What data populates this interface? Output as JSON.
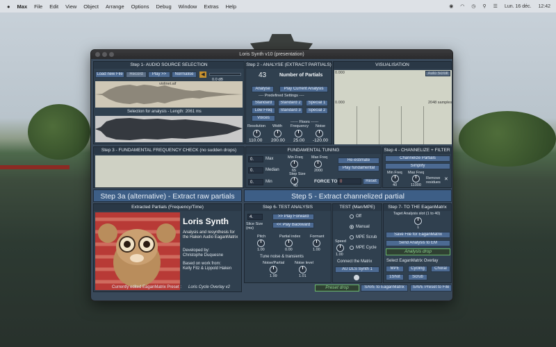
{
  "menubar": {
    "apple": "",
    "items": [
      "Max",
      "File",
      "Edit",
      "View",
      "Object",
      "Arrange",
      "Options",
      "Debug",
      "Window",
      "Extras",
      "Help"
    ],
    "date": "Lun. 16 déc.",
    "time": "12:42"
  },
  "window": {
    "title": "Loris Synth v10 (presentation)"
  },
  "step1": {
    "title": "Step 1- AUDIO SOURCE SELECTION",
    "load": "Load new File",
    "record": "Record",
    "play": "Play >>",
    "normalise": "Normalise",
    "db": "0.0 dB",
    "filename": "violinet.aif",
    "selection_label": "Selection for analysis - Length:",
    "selection_length": "2061",
    "selection_unit": "ms"
  },
  "step2": {
    "title": "Step 2 - ANALYSE (EXTRACT PARTIALS)",
    "partials_num": "43",
    "partials_label": "Number of  Partials",
    "analyse": "Analyse",
    "play_current": "Play Current Analysis",
    "predef_label": "---- Predefined Settings ----",
    "presets": [
      "Standard",
      "Standard 2",
      "Special 1",
      "Low Freq",
      "Standard 3",
      "Special 2",
      "Voices"
    ],
    "floors_label": "------ Floors ------",
    "params": [
      {
        "label": "Resolution",
        "value": "110.00"
      },
      {
        "label": "Width",
        "value": "200.00"
      },
      {
        "label": "Frequency",
        "value": "25.00"
      },
      {
        "label": "Noise",
        "value": "-120.00"
      }
    ]
  },
  "visual": {
    "title": "VISUALISATION",
    "auto_scroll": "Auto Scroll",
    "top_val": "0.000",
    "mid_val": "0.000",
    "samples": "2048 samples"
  },
  "step3": {
    "title": "Step 3 - FUNDAMENTAL FREQUENCY CHECK (no sudden drops)"
  },
  "tuning": {
    "title": "FUNDAMENTAL TUNING",
    "max_label": "Max",
    "median_label": "Median",
    "min_label": "Min",
    "max_val": "0.",
    "median_val": "0.",
    "min_val": "0.",
    "min_freq": "Min Freq",
    "min_freq_val": "65",
    "max_freq": "Max Freq",
    "max_freq_val": "2000",
    "step_size": "Step Size",
    "step_val": "40",
    "reestimate": "Re-estimate",
    "play_fund": "Play fundamental",
    "force_to": "FORCE TO",
    "force_val": "0",
    "reset": "Reset"
  },
  "step4": {
    "title": "Step 4 - CHANNELIZE + FILTER",
    "channelize": "Channelize Partials",
    "simplify": "Simplify",
    "min_freq": "Min Freq",
    "min_val": "40",
    "max_freq": "Max Freq",
    "max_val": "11000",
    "remove": "Remove residues",
    "close": "✕"
  },
  "step3a": {
    "title": "Step 3a (alternative) - Extract raw partials"
  },
  "step5": {
    "title": "Step 5 - Extract channelized partial"
  },
  "extracted": {
    "title": "Extracted Partials (Frequency/Time)",
    "name": "Loris Synth",
    "desc": "Analysis and resynthesis for the Haken Audio EaganMatrix",
    "dev_label": "Developed by:",
    "dev": "Christophe Duquesne",
    "based_label": "Based on work from:",
    "based": "Kelly Fitz & Lippold Haken",
    "current_label": "Currently edited EaganMatrix Preset :",
    "current": "Loris Cycle Overlay v2"
  },
  "step6": {
    "title": "Step 6- TEST ANALYSIS",
    "slice_val": "4.",
    "slice_label": "Slice Size (ms)",
    "play_fwd": ">> Play Forward",
    "play_bwd": "<< Play Backward",
    "pitch": "Pitch",
    "pitch_val": "1.00",
    "pindex": "Partial index",
    "pindex_val": "0.00",
    "formant": "Formant",
    "formant_val": "1.00",
    "tune_label": "Tune noise & transients",
    "noise_partial": "Noise/Partial",
    "np_val": "1.99",
    "noise_level": "Noise level",
    "nl_val": "1.01",
    "preset_drop": "Preset drop"
  },
  "test": {
    "title": "TEST  (Man/MPE)",
    "options": [
      "Off",
      "Manual",
      "MPE Scrub",
      "MPE Cycle"
    ],
    "selected": 1,
    "speed": "Speed",
    "speed_val": "1.00",
    "connect": "Connect the Matrix",
    "synth": "AU DLS Synth 1"
  },
  "step7": {
    "title": "Step 7- TO THE EaganMatrix",
    "target": "Taget Analysis slot (1 to 40)",
    "slot": "1",
    "save_file": "Save File for EaganMatrix",
    "send": "Send Analysis to EM",
    "drop": "Analysis drop",
    "overlay_label": "Select  EaganMatrix Overlay",
    "overlays": [
      "MPE",
      "Cycling",
      "Choral",
      "1Shot",
      "Scrub"
    ],
    "save_em": "SAVE to EaganMatrix",
    "save_preset": "SAVE Preset to File"
  }
}
